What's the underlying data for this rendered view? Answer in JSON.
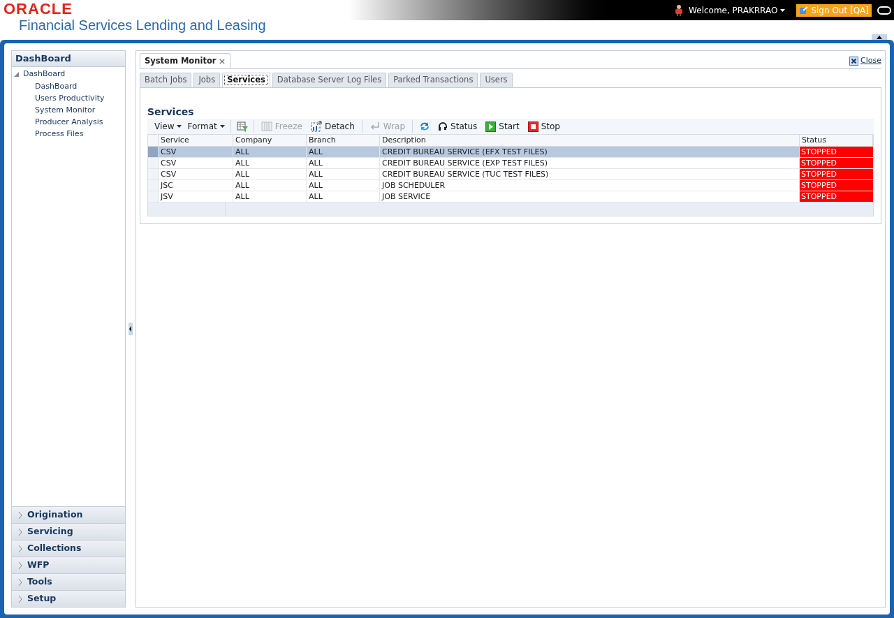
{
  "header": {
    "logo": "ORACLE",
    "title": "Financial Services Lending and Leasing",
    "welcome": "Welcome, PRAKRRAO",
    "sign_out": "Sign Out [QA]"
  },
  "sidebar": {
    "title": "DashBoard",
    "tree": [
      {
        "label": "DashBoard",
        "expanded": true,
        "children": [
          {
            "label": "DashBoard"
          },
          {
            "label": "Users Productivity"
          },
          {
            "label": "System Monitor"
          },
          {
            "label": "Producer Analysis"
          },
          {
            "label": "Process Files"
          }
        ]
      }
    ],
    "sections": [
      {
        "label": "Origination",
        "expanded": false
      },
      {
        "label": "Servicing",
        "expanded": false
      },
      {
        "label": "Collections",
        "expanded": false
      },
      {
        "label": "WFP",
        "expanded": false
      },
      {
        "label": "Tools",
        "expanded": false
      },
      {
        "label": "Setup",
        "expanded": false
      }
    ]
  },
  "page_tab": {
    "label": "System Monitor",
    "close_glyph": "×"
  },
  "close": "Close",
  "tabs": [
    {
      "label": "Batch Jobs",
      "selected": false
    },
    {
      "label": "Jobs",
      "selected": false
    },
    {
      "label": "Services",
      "selected": true
    },
    {
      "label": "Database Server Log Files",
      "selected": false
    },
    {
      "label": "Parked Transactions",
      "selected": false
    },
    {
      "label": "Users",
      "selected": false
    }
  ],
  "heading": "Services",
  "toolbar": [
    {
      "kind": "menu",
      "label": "View"
    },
    {
      "kind": "menu",
      "label": "Format"
    },
    {
      "kind": "separator"
    },
    {
      "kind": "filter"
    },
    {
      "kind": "separator"
    },
    {
      "kind": "freeze",
      "label": "Freeze",
      "disabled": true
    },
    {
      "kind": "detach",
      "label": "Detach",
      "disabled": false
    },
    {
      "kind": "separator"
    },
    {
      "kind": "wrap",
      "label": "Wrap",
      "disabled": true
    },
    {
      "kind": "separator"
    },
    {
      "kind": "refresh"
    },
    {
      "kind": "status",
      "label": "Status",
      "disabled": false
    },
    {
      "kind": "start",
      "label": "Start",
      "disabled": false
    },
    {
      "kind": "stop",
      "label": "Stop",
      "disabled": false
    }
  ],
  "table": {
    "columns": [
      "Service",
      "Company",
      "Branch",
      "Description",
      "Status"
    ],
    "rows": [
      {
        "selected": true,
        "cells": [
          "CSV",
          "ALL",
          "ALL",
          "CREDIT BUREAU SERVICE (EFX TEST FILES)",
          "STOPPED"
        ]
      },
      {
        "selected": false,
        "cells": [
          "CSV",
          "ALL",
          "ALL",
          "CREDIT BUREAU SERVICE (EXP TEST FILES)",
          "STOPPED"
        ]
      },
      {
        "selected": false,
        "cells": [
          "CSV",
          "ALL",
          "ALL",
          "CREDIT BUREAU SERVICE (TUC TEST FILES)",
          "STOPPED"
        ]
      },
      {
        "selected": false,
        "cells": [
          "JSC",
          "ALL",
          "ALL",
          "JOB SCHEDULER",
          "STOPPED"
        ]
      },
      {
        "selected": false,
        "cells": [
          "JSV",
          "ALL",
          "ALL",
          "JOB SERVICE",
          "STOPPED"
        ]
      }
    ]
  }
}
